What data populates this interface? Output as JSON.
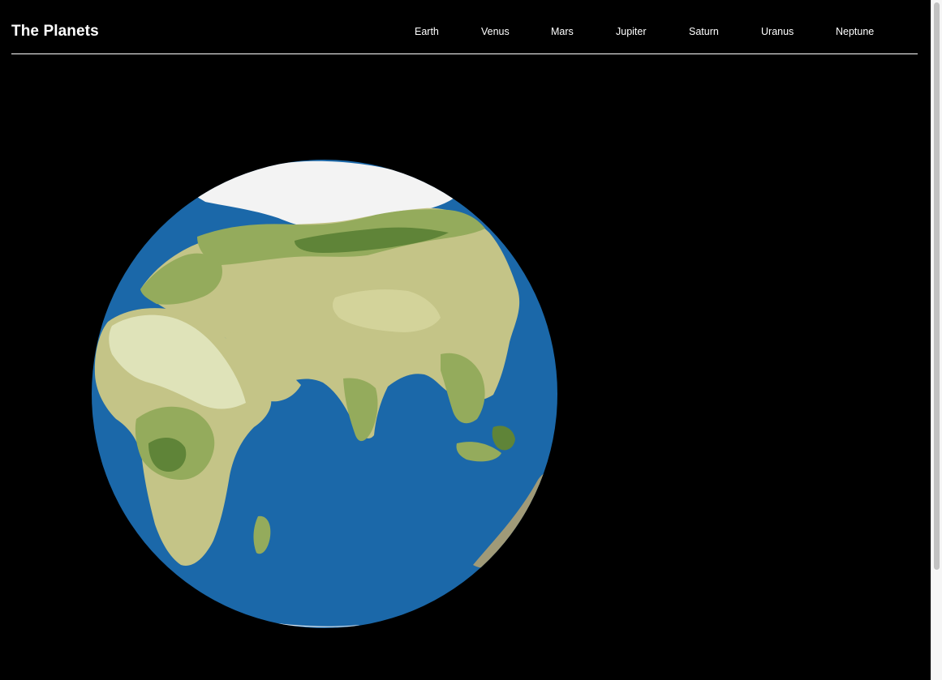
{
  "header": {
    "title": "The Planets"
  },
  "nav": {
    "items": [
      {
        "label": "Earth"
      },
      {
        "label": "Venus"
      },
      {
        "label": "Mars"
      },
      {
        "label": "Jupiter"
      },
      {
        "label": "Saturn"
      },
      {
        "label": "Uranus"
      },
      {
        "label": "Neptune"
      }
    ]
  },
  "planet": {
    "icon": "earth-globe-image"
  },
  "colors": {
    "background": "#000000",
    "text": "#ffffff",
    "ocean": "#1b68a9",
    "land_light": "#c4c487",
    "land_green": "#94ab5c",
    "land_dark": "#5f8438",
    "desert": "#dfe3b9",
    "ice": "#f3f3f3"
  }
}
